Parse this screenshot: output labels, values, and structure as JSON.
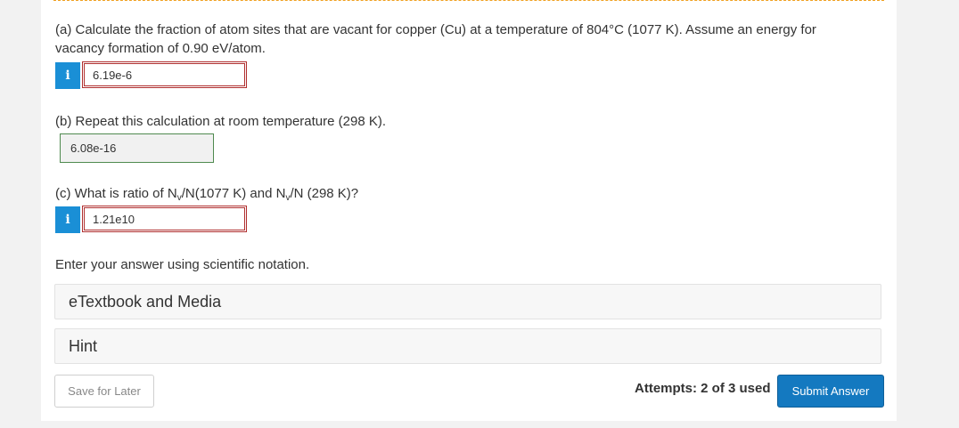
{
  "part_a": {
    "question": "(a) Calculate the fraction of atom sites that are vacant for copper (Cu) at a temperature of 804°C (1077 K). Assume an energy for vacancy formation of 0.90 eV/atom.",
    "info_icon": "i",
    "answer": "6.19e-6"
  },
  "part_b": {
    "question": "(b) Repeat this calculation at room temperature (298 K).",
    "answer": "6.08e-16"
  },
  "part_c": {
    "q_pre": "(c) What is ratio of N",
    "q_sub1": "v",
    "q_mid": "/N(1077 K) and N",
    "q_sub2": "v",
    "q_post": "/N (298 K)?",
    "info_icon": "i",
    "answer": "1.21e10"
  },
  "instruction": "Enter your answer using scientific notation.",
  "accordions": {
    "etextbook": "eTextbook and Media",
    "hint": "Hint"
  },
  "footer": {
    "save_label": "Save for Later",
    "attempts": "Attempts: 2 of 3 used",
    "submit_label": "Submit Answer"
  },
  "colors": {
    "info_badge": "#1a8fd6",
    "incorrect_border": "#b03030",
    "correct_border": "#4f8a4f",
    "submit_bg": "#1479c0"
  }
}
